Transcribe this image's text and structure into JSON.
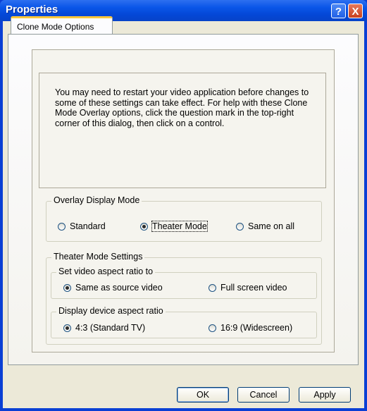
{
  "window": {
    "title": "Properties"
  },
  "titlebar": {
    "help_glyph": "?",
    "close_glyph": "X"
  },
  "tabs": [
    {
      "label": "Clone Mode Options"
    }
  ],
  "info": {
    "text": "You may need to restart your video application before changes to some of these settings can take effect. For help with these Clone Mode Overlay options, click the question mark in the top-right corner of this dialog, then click on a control."
  },
  "overlay": {
    "label": "Overlay Display Mode",
    "options": [
      {
        "label": "Standard",
        "selected": false
      },
      {
        "label": "Theater Mode",
        "selected": true
      },
      {
        "label": "Same on all",
        "selected": false
      }
    ]
  },
  "theater": {
    "label": "Theater Mode Settings",
    "aspect": {
      "label": "Set video aspect ratio to",
      "options": [
        {
          "label": "Same as source video",
          "selected": true
        },
        {
          "label": "Full screen video",
          "selected": false
        }
      ]
    },
    "device": {
      "label": "Display device aspect ratio",
      "options": [
        {
          "label": "4:3 (Standard TV)",
          "selected": true
        },
        {
          "label": "16:9 (Widescreen)",
          "selected": false
        }
      ]
    }
  },
  "buttons": {
    "ok": "OK",
    "cancel": "Cancel",
    "apply": "Apply"
  }
}
